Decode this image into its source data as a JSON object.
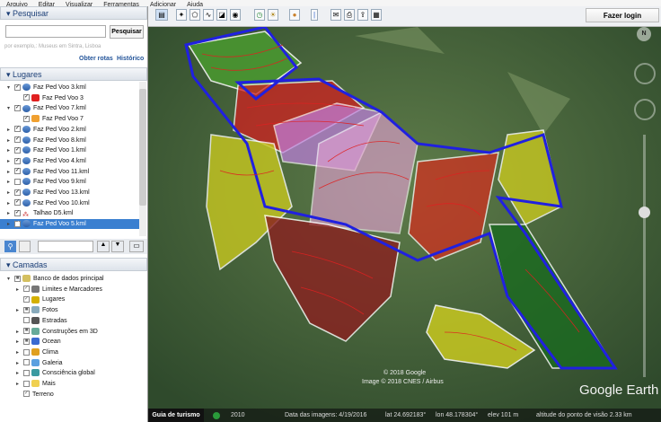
{
  "menu": [
    "Arquivo",
    "Editar",
    "Visualizar",
    "Ferramentas",
    "Adicionar",
    "Ajuda"
  ],
  "search": {
    "title": "Pesquisar",
    "value": "",
    "button": "Pesquisar",
    "hint": "por exemplo,: Museus em Sintra, Lisboa",
    "routes": "Obter rotas",
    "history": "Histórico"
  },
  "places": {
    "title": "Lugares",
    "items": [
      {
        "label": "Faz Ped Voo 3.kml",
        "checked": true,
        "indent": 0
      },
      {
        "label": "Faz Ped Voo 3",
        "checked": true,
        "indent": 1,
        "color": "#e02020"
      },
      {
        "label": "Faz Ped Voo 7.kml",
        "checked": true,
        "indent": 0
      },
      {
        "label": "Faz Ped Voo 7",
        "checked": true,
        "indent": 1,
        "color": "#f0a030"
      },
      {
        "label": "Faz Ped Voo 2.kml",
        "checked": true,
        "indent": 0
      },
      {
        "label": "Faz Ped Voo 8.kml",
        "checked": true,
        "indent": 0
      },
      {
        "label": "Faz Ped Voo 1.kml",
        "checked": true,
        "indent": 0
      },
      {
        "label": "Faz Ped Voo 4.kml",
        "checked": true,
        "indent": 0
      },
      {
        "label": "Faz Ped Voo 11.kml",
        "checked": true,
        "indent": 0
      },
      {
        "label": "Faz Ped Voo 9.kml",
        "checked": false,
        "indent": 0
      },
      {
        "label": "Faz Ped Voo 13.kml",
        "checked": true,
        "indent": 0
      },
      {
        "label": "Faz Ped Voo 10.kml",
        "checked": true,
        "indent": 0
      },
      {
        "label": "Talhao D5.kml",
        "checked": true,
        "indent": 0
      },
      {
        "label": "Faz Ped Voo 5.kml",
        "checked": true,
        "indent": 0,
        "selected": true
      }
    ]
  },
  "layers": {
    "title": "Camadas",
    "items": [
      {
        "label": "Banco de dados principal",
        "state": "partial",
        "indent": 0
      },
      {
        "label": "Limites e Marcadores",
        "state": "checked",
        "indent": 1
      },
      {
        "label": "Lugares",
        "state": "checked",
        "indent": 1
      },
      {
        "label": "Fotos",
        "state": "partial",
        "indent": 1
      },
      {
        "label": "Estradas",
        "state": "unchecked",
        "indent": 1
      },
      {
        "label": "Construções em 3D",
        "state": "partial",
        "indent": 1
      },
      {
        "label": "Ocean",
        "state": "partial",
        "indent": 1
      },
      {
        "label": "Clima",
        "state": "unchecked",
        "indent": 1
      },
      {
        "label": "Galeria",
        "state": "unchecked",
        "indent": 1
      },
      {
        "label": "Consciência global",
        "state": "unchecked",
        "indent": 1
      },
      {
        "label": "Mais",
        "state": "unchecked",
        "indent": 1
      },
      {
        "label": "Terreno",
        "state": "checked",
        "indent": 1
      }
    ]
  },
  "toolbar": {
    "login": "Fazer login"
  },
  "map": {
    "copyright1": "© 2018 Google",
    "copyright2": "Image © 2018 CNES / Airbus",
    "logo": "Google Earth",
    "compass": "N"
  },
  "status": {
    "tour": "Guia de turismo",
    "year": "2010",
    "date": "Data das imagens: 4/19/2016",
    "lat": "lat  24.692183°",
    "lon": "lon  48.178304°",
    "elev": "elev  101 m",
    "alt": "altitude do ponto de visão  2.33 km"
  }
}
